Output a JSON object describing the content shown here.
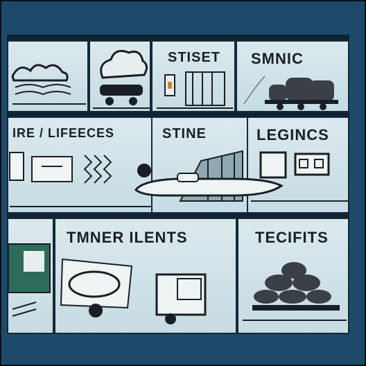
{
  "panels": {
    "p1": {
      "caption": ""
    },
    "p2": {
      "caption": ""
    },
    "p3": {
      "caption": "STISET"
    },
    "p4": {
      "caption": "SMNIC"
    },
    "p5": {
      "caption": "IRE / LIFEECES"
    },
    "p6": {
      "caption": "STINE"
    },
    "p7": {
      "caption": "LEGINCS"
    },
    "p8": {
      "caption": ""
    },
    "p9": {
      "caption": "TMNER ILENTS"
    },
    "p10": {
      "caption": "TECIFITS"
    }
  },
  "colors": {
    "frame": "#1d4a6a",
    "panel": "#d4e4ea",
    "ink": "#1a1f24",
    "accent_green": "#2e6b5a"
  }
}
